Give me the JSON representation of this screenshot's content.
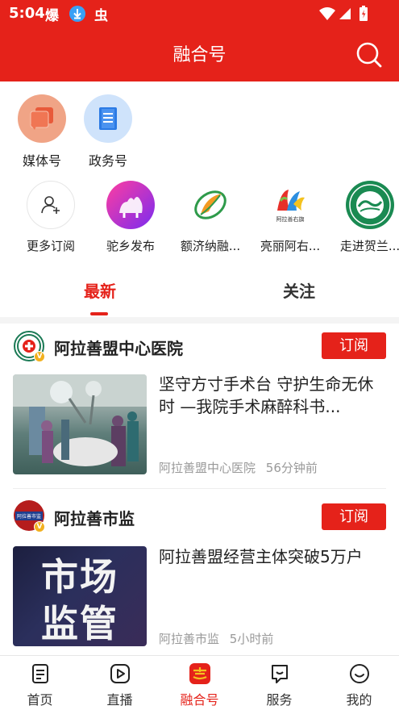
{
  "status_bar": {
    "time": "5:04",
    "notification_1": "爆",
    "notification_2": "虫"
  },
  "header": {
    "title": "融合号"
  },
  "categories": [
    {
      "label": "媒体号",
      "icon": "media-stack-icon",
      "color": "#f0a486"
    },
    {
      "label": "政务号",
      "icon": "document-icon",
      "color": "#cfe3fb"
    }
  ],
  "subscriptions": [
    {
      "label": "更多订阅",
      "icon": "add-user-icon"
    },
    {
      "label": "驼乡发布",
      "icon": "camel-logo-icon"
    },
    {
      "label": "额济纳融...",
      "icon": "leaf-logo-icon"
    },
    {
      "label": "亮丽阿右...",
      "icon": "colorful-logo-icon",
      "caption": "阿拉善右旗"
    },
    {
      "label": "走进贺兰...",
      "icon": "nature-reserve-logo-icon"
    }
  ],
  "tabs": {
    "latest": "最新",
    "following": "关注"
  },
  "feed": [
    {
      "source": "阿拉善盟中心医院",
      "subscribe": "订阅",
      "headline": "坚守方寸手术台 守护生命无休时 —我院手术麻醉科书...",
      "meta_source": "阿拉善盟中心医院",
      "meta_time": "56分钟前"
    },
    {
      "source": "阿拉善市监",
      "subscribe": "订阅",
      "headline": "阿拉善盟经营主体突破5万户",
      "meta_source": "阿拉善市监",
      "meta_time": "5小时前",
      "thumb_line1": "市场",
      "thumb_line2": "监管",
      "avatar_text": "阿拉善市监"
    }
  ],
  "bottom_nav": [
    {
      "label": "首页",
      "icon": "home-doc-icon"
    },
    {
      "label": "直播",
      "icon": "play-icon"
    },
    {
      "label": "融合号",
      "icon": "ronghe-logo-icon",
      "active": true
    },
    {
      "label": "服务",
      "icon": "service-flag-icon"
    },
    {
      "label": "我的",
      "icon": "smile-icon"
    }
  ],
  "colors": {
    "brand_red": "#e5221a",
    "meta_gray": "#999999"
  }
}
